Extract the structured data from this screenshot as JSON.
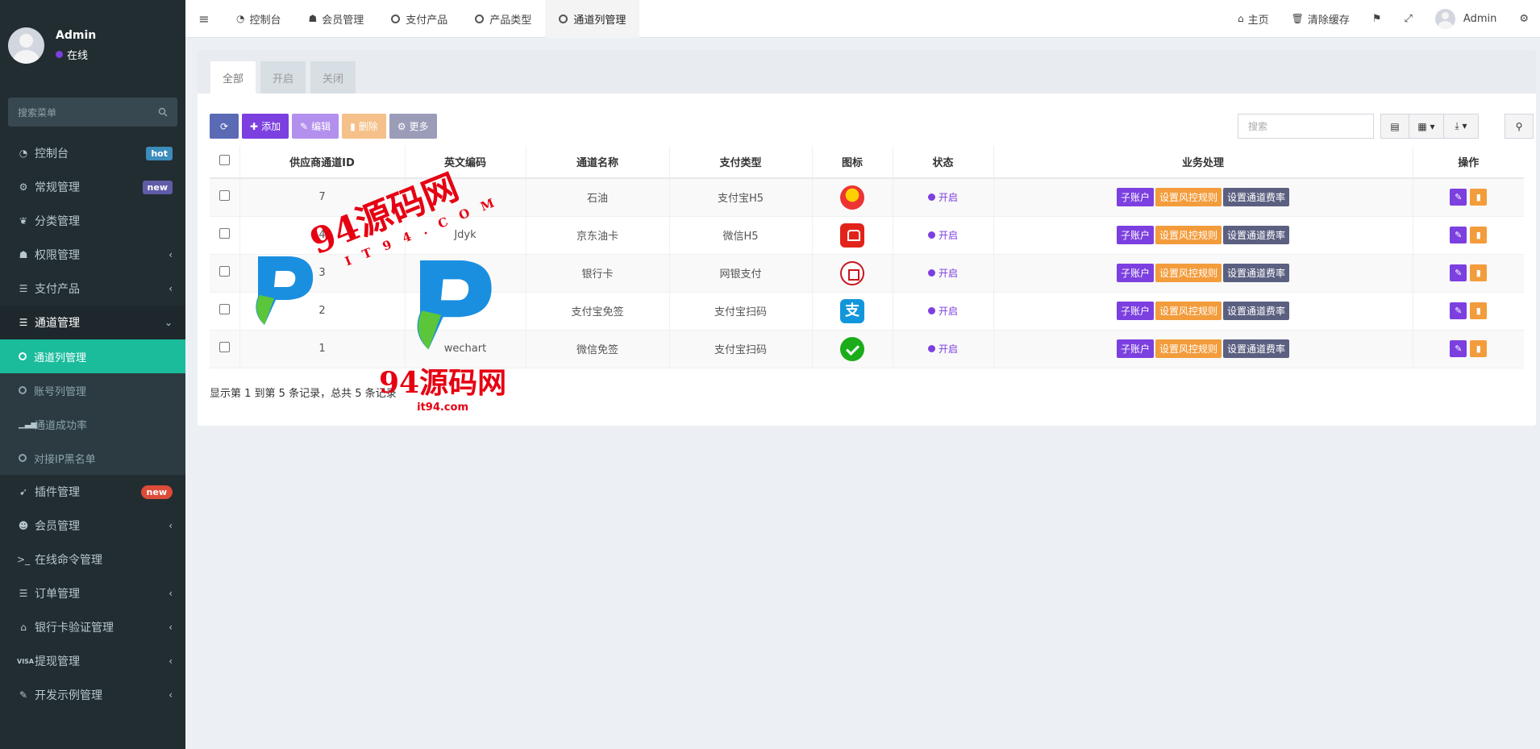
{
  "sidebar": {
    "user": {
      "name": "Admin",
      "status": "在线"
    },
    "search_placeholder": "搜索菜单",
    "items": [
      {
        "icon": "dashboard-icon",
        "label": "控制台",
        "badge": "hot"
      },
      {
        "icon": "cogs-icon",
        "label": "常规管理",
        "badge": "new"
      },
      {
        "icon": "leaf-icon",
        "label": "分类管理"
      },
      {
        "icon": "group-icon",
        "label": "权限管理",
        "chevron": "‹"
      },
      {
        "icon": "list-icon",
        "label": "支付产品",
        "chevron": "‹"
      },
      {
        "icon": "list-icon",
        "label": "通道管理",
        "chevron": "⌄"
      },
      {
        "icon": "circle-icon",
        "label": "通道列管理"
      },
      {
        "icon": "circle-icon",
        "label": "账号列管理"
      },
      {
        "icon": "signal-icon",
        "label": "通道成功率"
      },
      {
        "icon": "circle-icon",
        "label": "对接IP黑名单"
      },
      {
        "icon": "rocket-icon",
        "label": "插件管理",
        "badge": "new"
      },
      {
        "icon": "user-circle-icon",
        "label": "会员管理",
        "chevron": "‹"
      },
      {
        "icon": "terminal-icon",
        "label": "在线命令管理"
      },
      {
        "icon": "list-icon",
        "label": "订单管理",
        "chevron": "‹"
      },
      {
        "icon": "bank-icon",
        "label": "银行卡验证管理",
        "chevron": "‹"
      },
      {
        "icon": "visa-icon",
        "label": "提现管理",
        "chevron": "‹"
      },
      {
        "icon": "magic-icon",
        "label": "开发示例管理",
        "chevron": "‹"
      }
    ]
  },
  "topbar": {
    "tabs": [
      {
        "label": "控制台",
        "icon": "dashboard-icon"
      },
      {
        "label": "会员管理",
        "icon": "user-icon"
      },
      {
        "label": "支付产品",
        "icon": "circle-icon"
      },
      {
        "label": "产品类型",
        "icon": "circle-icon"
      },
      {
        "label": "通道列管理",
        "icon": "circle-icon"
      }
    ],
    "home": "主页",
    "clear_cache": "清除缓存",
    "user": "Admin"
  },
  "panel": {
    "tabs": [
      "全部",
      "开启",
      "关闭"
    ],
    "toolbar": {
      "add": "添加",
      "edit": "编辑",
      "delete": "删除",
      "more": "更多"
    },
    "search_placeholder": "搜索",
    "columns": [
      "供应商通道ID",
      "英文编码",
      "通道名称",
      "支付类型",
      "图标",
      "状态",
      "业务处理",
      "操作"
    ],
    "rows": [
      {
        "id": "7",
        "code": "",
        "name": "石油",
        "pay_type": "支付宝H5",
        "icon": "sinopec-icon",
        "status": "开启"
      },
      {
        "id": "4",
        "code": "Jdyk",
        "name": "京东油卡",
        "pay_type": "微信H5",
        "icon": "jd-icon",
        "status": "开启"
      },
      {
        "id": "3",
        "code": "",
        "name": "银行卡",
        "pay_type": "网银支付",
        "icon": "bank-icon",
        "status": "开启"
      },
      {
        "id": "2",
        "code": "",
        "name": "支付宝免签",
        "pay_type": "支付宝扫码",
        "icon": "alipay-icon",
        "status": "开启"
      },
      {
        "id": "1",
        "code": "wechart",
        "name": "微信免签",
        "pay_type": "支付宝扫码",
        "icon": "wechat-icon",
        "status": "开启"
      }
    ],
    "business_buttons": [
      "子账户",
      "设置风控规则",
      "设置通道费率"
    ],
    "footer": "显示第 1 到第 5 条记录，总共 5 条记录"
  },
  "watermark": {
    "text": "94源码网",
    "sub": "IT94.COM",
    "domain": "it94.com"
  },
  "colors": {
    "sidebar": "#222d32",
    "accent": "#7c3fe0",
    "active": "#1abc9c",
    "orange": "#f39c3c"
  }
}
